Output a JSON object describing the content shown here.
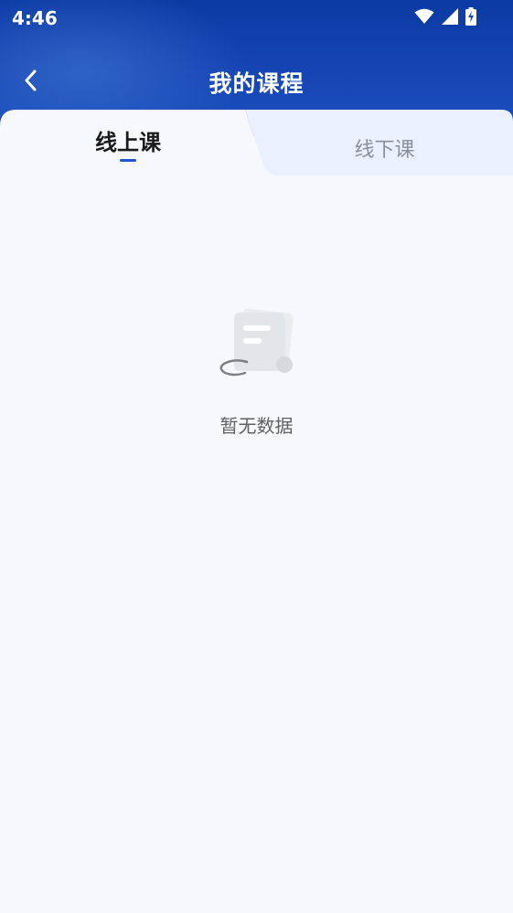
{
  "status_bar": {
    "time": "4:46"
  },
  "nav": {
    "title": "我的课程"
  },
  "tabs": [
    {
      "label": "线上课",
      "active": true
    },
    {
      "label": "线下课",
      "active": false
    }
  ],
  "empty_state": {
    "message": "暂无数据"
  },
  "colors": {
    "header_blue": "#0b3aa3",
    "accent": "#2255d4",
    "background": "#f7f8fb",
    "inactive_tab_bg": "#eaf0fd"
  }
}
